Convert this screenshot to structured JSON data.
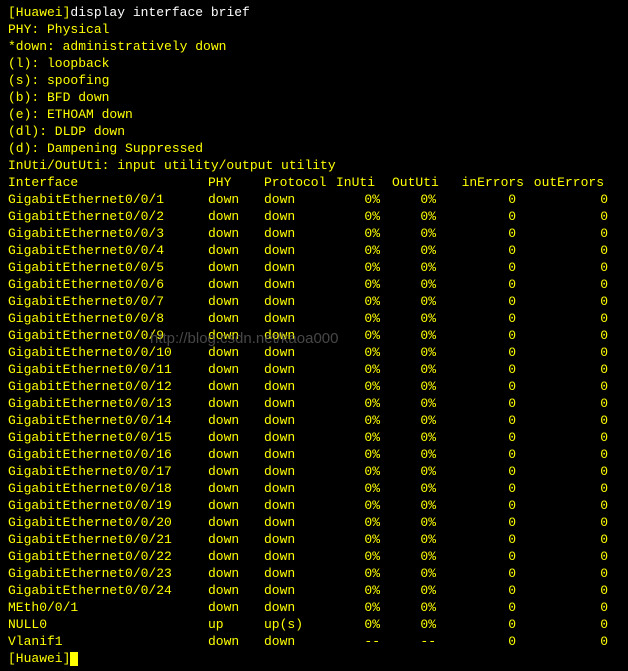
{
  "header": {
    "line1_prefix": "[Huawei]",
    "line1_cmd": "display interface brief",
    "legend": [
      "PHY: Physical",
      "*down: administratively down",
      "(l): loopback",
      "(s): spoofing",
      "(b): BFD down",
      "(e): ETHOAM down",
      "(dl): DLDP down",
      "(d): Dampening Suppressed",
      "InUti/OutUti: input utility/output utility"
    ]
  },
  "columns": {
    "interface": "Interface",
    "phy": "PHY",
    "protocol": "Protocol",
    "inuti": "InUti",
    "oututi": "OutUti",
    "inerrors": "inErrors",
    "outerrors": "outErrors"
  },
  "rows": [
    {
      "if": "GigabitEthernet0/0/1",
      "phy": "down",
      "proto": "down",
      "in": "0%",
      "out": "0%",
      "ie": "0",
      "oe": "0"
    },
    {
      "if": "GigabitEthernet0/0/2",
      "phy": "down",
      "proto": "down",
      "in": "0%",
      "out": "0%",
      "ie": "0",
      "oe": "0"
    },
    {
      "if": "GigabitEthernet0/0/3",
      "phy": "down",
      "proto": "down",
      "in": "0%",
      "out": "0%",
      "ie": "0",
      "oe": "0"
    },
    {
      "if": "GigabitEthernet0/0/4",
      "phy": "down",
      "proto": "down",
      "in": "0%",
      "out": "0%",
      "ie": "0",
      "oe": "0"
    },
    {
      "if": "GigabitEthernet0/0/5",
      "phy": "down",
      "proto": "down",
      "in": "0%",
      "out": "0%",
      "ie": "0",
      "oe": "0"
    },
    {
      "if": "GigabitEthernet0/0/6",
      "phy": "down",
      "proto": "down",
      "in": "0%",
      "out": "0%",
      "ie": "0",
      "oe": "0"
    },
    {
      "if": "GigabitEthernet0/0/7",
      "phy": "down",
      "proto": "down",
      "in": "0%",
      "out": "0%",
      "ie": "0",
      "oe": "0"
    },
    {
      "if": "GigabitEthernet0/0/8",
      "phy": "down",
      "proto": "down",
      "in": "0%",
      "out": "0%",
      "ie": "0",
      "oe": "0"
    },
    {
      "if": "GigabitEthernet0/0/9",
      "phy": "down",
      "proto": "down",
      "in": "0%",
      "out": "0%",
      "ie": "0",
      "oe": "0"
    },
    {
      "if": "GigabitEthernet0/0/10",
      "phy": "down",
      "proto": "down",
      "in": "0%",
      "out": "0%",
      "ie": "0",
      "oe": "0"
    },
    {
      "if": "GigabitEthernet0/0/11",
      "phy": "down",
      "proto": "down",
      "in": "0%",
      "out": "0%",
      "ie": "0",
      "oe": "0"
    },
    {
      "if": "GigabitEthernet0/0/12",
      "phy": "down",
      "proto": "down",
      "in": "0%",
      "out": "0%",
      "ie": "0",
      "oe": "0"
    },
    {
      "if": "GigabitEthernet0/0/13",
      "phy": "down",
      "proto": "down",
      "in": "0%",
      "out": "0%",
      "ie": "0",
      "oe": "0"
    },
    {
      "if": "GigabitEthernet0/0/14",
      "phy": "down",
      "proto": "down",
      "in": "0%",
      "out": "0%",
      "ie": "0",
      "oe": "0"
    },
    {
      "if": "GigabitEthernet0/0/15",
      "phy": "down",
      "proto": "down",
      "in": "0%",
      "out": "0%",
      "ie": "0",
      "oe": "0"
    },
    {
      "if": "GigabitEthernet0/0/16",
      "phy": "down",
      "proto": "down",
      "in": "0%",
      "out": "0%",
      "ie": "0",
      "oe": "0"
    },
    {
      "if": "GigabitEthernet0/0/17",
      "phy": "down",
      "proto": "down",
      "in": "0%",
      "out": "0%",
      "ie": "0",
      "oe": "0"
    },
    {
      "if": "GigabitEthernet0/0/18",
      "phy": "down",
      "proto": "down",
      "in": "0%",
      "out": "0%",
      "ie": "0",
      "oe": "0"
    },
    {
      "if": "GigabitEthernet0/0/19",
      "phy": "down",
      "proto": "down",
      "in": "0%",
      "out": "0%",
      "ie": "0",
      "oe": "0"
    },
    {
      "if": "GigabitEthernet0/0/20",
      "phy": "down",
      "proto": "down",
      "in": "0%",
      "out": "0%",
      "ie": "0",
      "oe": "0"
    },
    {
      "if": "GigabitEthernet0/0/21",
      "phy": "down",
      "proto": "down",
      "in": "0%",
      "out": "0%",
      "ie": "0",
      "oe": "0"
    },
    {
      "if": "GigabitEthernet0/0/22",
      "phy": "down",
      "proto": "down",
      "in": "0%",
      "out": "0%",
      "ie": "0",
      "oe": "0"
    },
    {
      "if": "GigabitEthernet0/0/23",
      "phy": "down",
      "proto": "down",
      "in": "0%",
      "out": "0%",
      "ie": "0",
      "oe": "0"
    },
    {
      "if": "GigabitEthernet0/0/24",
      "phy": "down",
      "proto": "down",
      "in": "0%",
      "out": "0%",
      "ie": "0",
      "oe": "0"
    },
    {
      "if": "MEth0/0/1",
      "phy": "down",
      "proto": "down",
      "in": "0%",
      "out": "0%",
      "ie": "0",
      "oe": "0"
    },
    {
      "if": "NULL0",
      "phy": "up",
      "proto": "up(s)",
      "in": "0%",
      "out": "0%",
      "ie": "0",
      "oe": "0"
    },
    {
      "if": "Vlanif1",
      "phy": "down",
      "proto": "down",
      "in": "--",
      "out": "--",
      "ie": "0",
      "oe": "0"
    }
  ],
  "prompt": "[Huawei]",
  "watermark": "http://blog.csdn.net/kaoa000"
}
